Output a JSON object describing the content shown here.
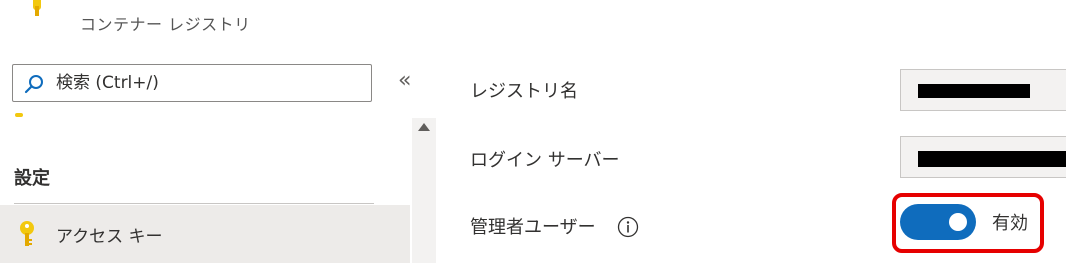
{
  "header": {
    "subtitle": "コンテナー レジストリ"
  },
  "sidebar": {
    "search": {
      "placeholder": "検索 (Ctrl+/)"
    },
    "collapse_label": "«",
    "section_heading": "設定",
    "items": [
      {
        "label": "アクセス キー",
        "icon": "key-icon",
        "selected": true
      }
    ]
  },
  "form": {
    "registry_name": {
      "label": "レジストリ名"
    },
    "login_server": {
      "label": "ログイン サーバー"
    },
    "admin_user": {
      "label": "管理者ユーザー",
      "toggle_value": "有効",
      "enabled": true
    }
  },
  "colors": {
    "accent": "#0f6cbd",
    "highlight": "#e60000",
    "key": "#f2c80f"
  }
}
